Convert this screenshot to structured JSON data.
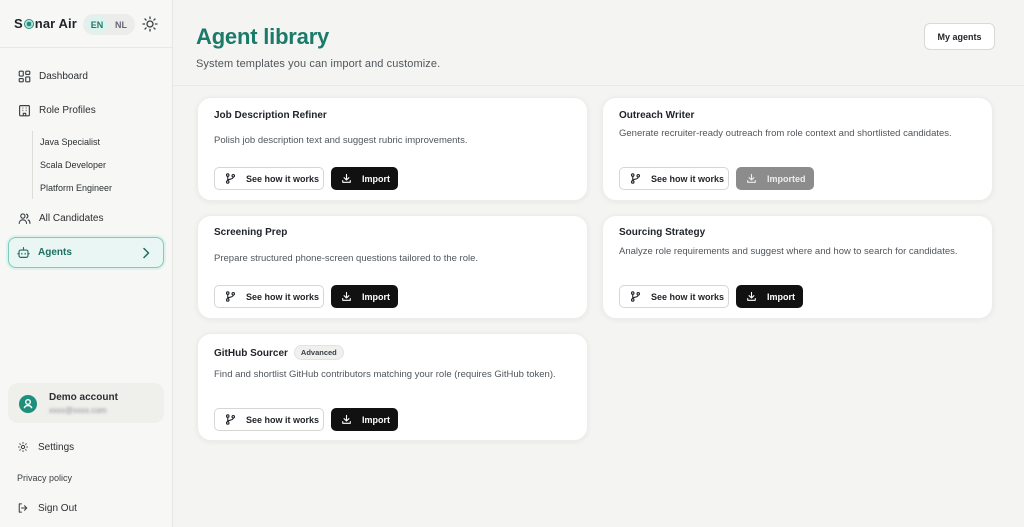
{
  "brand": {
    "prefix": "S",
    "suffix": "nar Air"
  },
  "lang": {
    "en": "EN",
    "nl": "NL"
  },
  "nav": {
    "dashboard": "Dashboard",
    "role_profiles": "Role Profiles",
    "sub_roles": [
      "Java Specialist",
      "Scala Developer",
      "Platform Engineer"
    ],
    "all_candidates": "All Candidates",
    "agents": "Agents"
  },
  "account": {
    "name": "Demo account",
    "email": "xxxx@xxxx.com"
  },
  "footer": {
    "settings": "Settings",
    "privacy": "Privacy policy",
    "sign_out": "Sign Out"
  },
  "page": {
    "title": "Agent library",
    "subtitle": "System templates you can import and customize.",
    "my_agents": "My agents"
  },
  "buttons": {
    "see": "See how it works",
    "import": "Import",
    "imported": "Imported"
  },
  "cards": [
    {
      "title": "Job Description Refiner",
      "desc": "Polish job description text and suggest rubric improvements.",
      "status": "Import"
    },
    {
      "title": "Outreach Writer",
      "desc": "Generate recruiter-ready outreach from role context and shortlisted candidates.",
      "status": "Imported"
    },
    {
      "title": "Screening Prep",
      "desc": "Prepare structured phone-screen questions tailored to the role.",
      "status": "Import"
    },
    {
      "title": "Sourcing Strategy",
      "desc": "Analyze role requirements and suggest where and how to search for candidates.",
      "status": "Import"
    },
    {
      "title": "GitHub Sourcer",
      "badge": "Advanced",
      "desc": "Find and shortlist GitHub contributors matching your role (requires GitHub token).",
      "status": "Import"
    }
  ],
  "colors": {
    "accent": "#1c7a6a",
    "active_bg": "#eaf6f3",
    "button_dark": "#111111",
    "button_disabled": "#8c8c8c"
  },
  "icons": [
    "dashboard-icon",
    "building-icon",
    "users-icon",
    "bot-icon",
    "sun-icon",
    "git-branch-icon",
    "download-icon",
    "user-icon",
    "gear-icon",
    "sign-out-icon",
    "chevron-right-icon"
  ]
}
